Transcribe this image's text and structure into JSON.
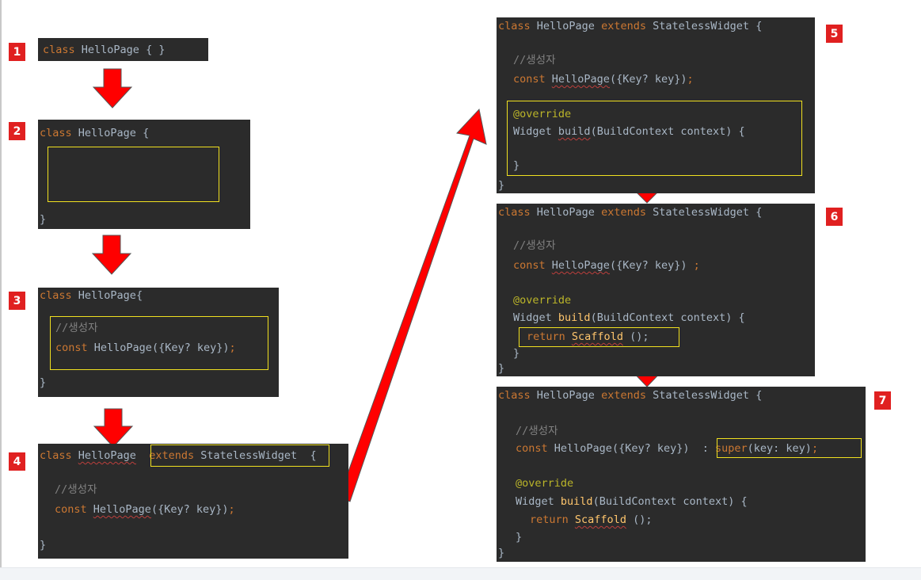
{
  "badges": [
    "1",
    "2",
    "3",
    "4",
    "5",
    "6",
    "7"
  ],
  "code": {
    "class_kw": "class",
    "class_name": "HelloPage",
    "empty_body": "{ }",
    "brace_open": "{",
    "brace_close": "}",
    "extends_kw": "extends",
    "base_class": "StatelessWidget",
    "comment": "//생성자",
    "const_kw": "const",
    "params": "({Key? key})",
    "semicolon": ";",
    "override": "@override",
    "widget_type": "Widget",
    "build_name": "build",
    "build_params": "(BuildContext context) {",
    "return_kw": "return",
    "scaffold": "Scaffold",
    "scaffold_call": " ();",
    "super_prefix": ": ",
    "super_kw": "super",
    "super_args": "(key: key)"
  },
  "colors": {
    "panel_bg": "#2b2b2b",
    "keyword": "#cc7832",
    "comment": "#808080",
    "function": "#ffc66d",
    "text": "#a9b7c6",
    "highlight_box": "#f0e020",
    "badge": "#e02020",
    "arrow": "#ff0000"
  }
}
